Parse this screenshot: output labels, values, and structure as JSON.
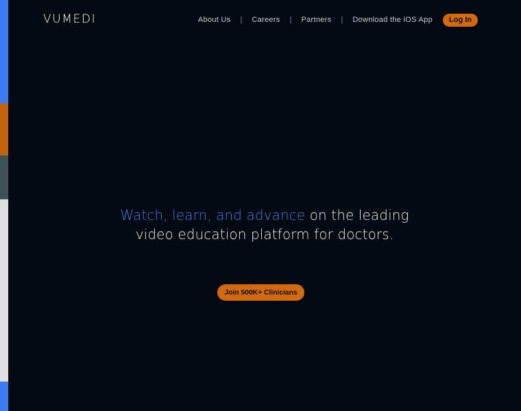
{
  "brand": {
    "logo_text": "VUMEDI"
  },
  "nav": {
    "items": [
      {
        "label": "About Us"
      },
      {
        "label": "Careers"
      },
      {
        "label": "Partners"
      },
      {
        "label": "Download the iOS App"
      }
    ],
    "separator": "|",
    "login_label": "Log In"
  },
  "hero": {
    "headline_accent": "Watch, learn, and advance",
    "headline_rest_1": "on the leading",
    "headline_rest_2": "video education platform for doctors.",
    "cta_label": "Join 500K+ Clinicians"
  },
  "colors": {
    "background": "#030a12",
    "accent_blue": "#3d7fe6",
    "accent_orange": "#d46a0c",
    "stripe": [
      "#3b7bf0",
      "#c4620f",
      "#3d5257",
      "#e0e0e0",
      "#3b7bf0"
    ]
  }
}
